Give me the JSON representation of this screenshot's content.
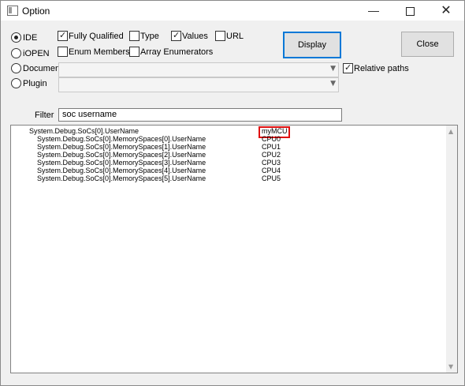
{
  "window": {
    "title": "Option"
  },
  "controls": {
    "ide": "IDE",
    "iopen": "iOPEN",
    "document": "Document",
    "plugin": "Plugin",
    "fully_qualified": "Fully Qualified",
    "type": "Type",
    "values": "Values",
    "url": "URL",
    "enum_members": "Enum Members",
    "array_enumerators": "Array Enumerators",
    "relative_paths": "Relative paths",
    "display": "Display",
    "close": "Close",
    "filter_label": "Filter",
    "filter_value": "soc username"
  },
  "list": {
    "rows": [
      {
        "name": "System.Debug.SoCs[0].UserName",
        "value": "myMCU"
      },
      {
        "name": "System.Debug.SoCs[0].MemorySpaces[0].UserName",
        "value": "CPU0"
      },
      {
        "name": "System.Debug.SoCs[0].MemorySpaces[1].UserName",
        "value": "CPU1"
      },
      {
        "name": "System.Debug.SoCs[0].MemorySpaces[2].UserName",
        "value": "CPU2"
      },
      {
        "name": "System.Debug.SoCs[0].MemorySpaces[3].UserName",
        "value": "CPU3"
      },
      {
        "name": "System.Debug.SoCs[0].MemorySpaces[4].UserName",
        "value": "CPU4"
      },
      {
        "name": "System.Debug.SoCs[0].MemorySpaces[5].UserName",
        "value": "CPU5"
      }
    ]
  },
  "colors": {
    "accent": "#0078d7",
    "highlight": "#e01010"
  }
}
